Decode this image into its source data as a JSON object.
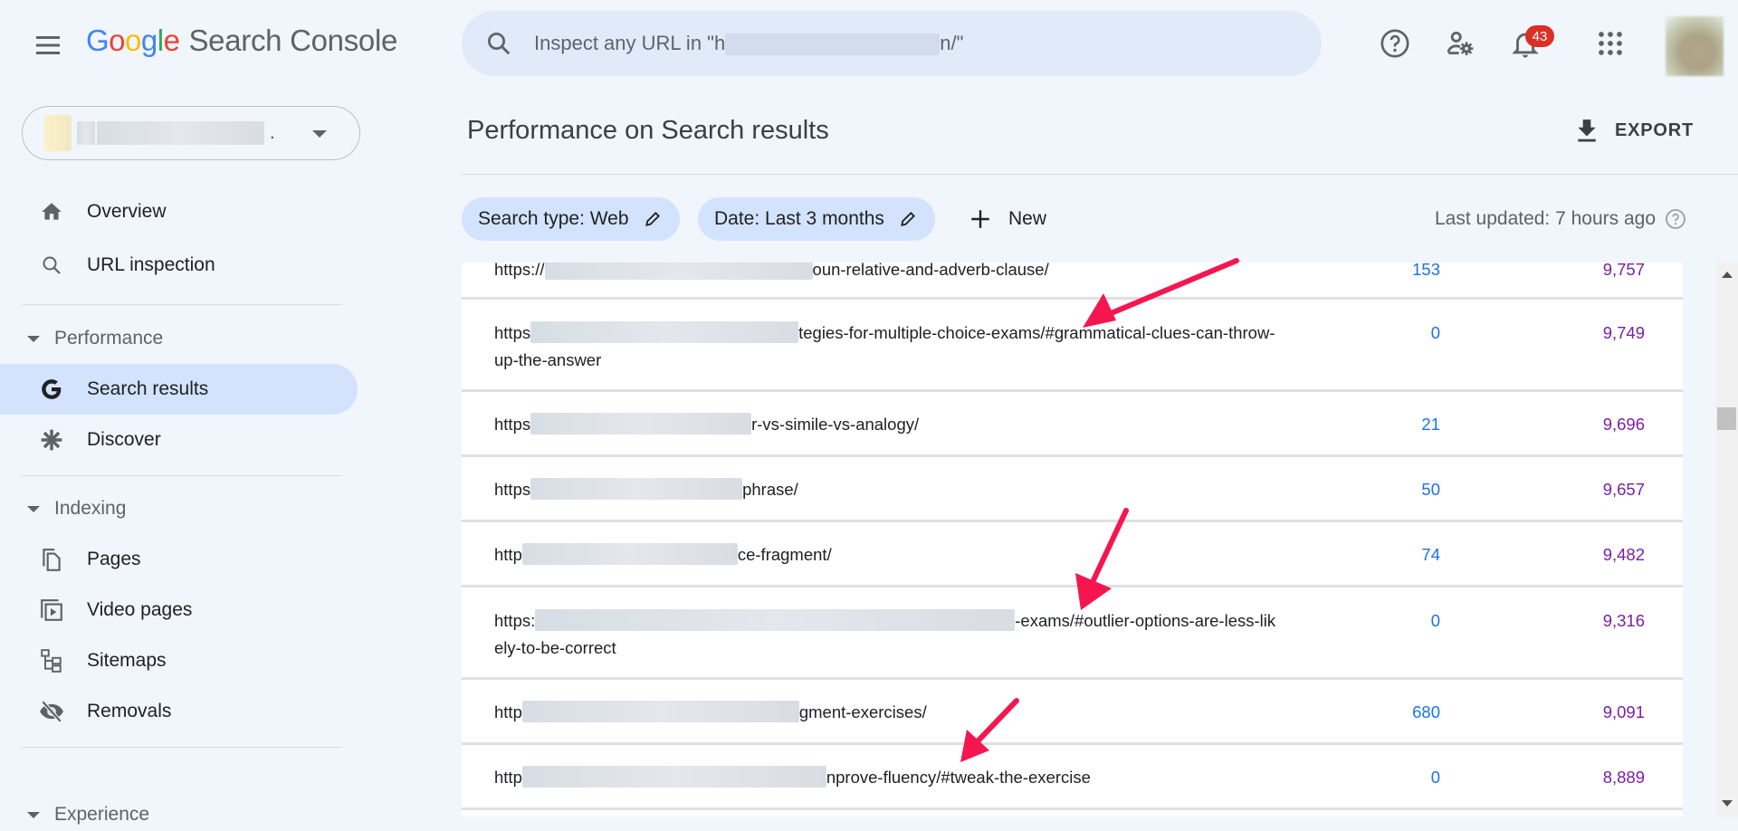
{
  "app": {
    "logo_google": [
      "G",
      "o",
      "o",
      "g",
      "l",
      "e"
    ],
    "logo_colors": [
      "#4285f4",
      "#ea4335",
      "#fbbc05",
      "#4285f4",
      "#34a853",
      "#ea4335"
    ],
    "product_name": "Search Console"
  },
  "search": {
    "placeholder_prefix": "Inspect any URL in \"h",
    "placeholder_suffix": "n/\""
  },
  "top_icons": {
    "help": "help-icon",
    "admin": "manage-accounts-icon",
    "notifications": "notifications-icon",
    "notification_count": "43",
    "apps": "apps-grid-icon"
  },
  "property": {
    "dot": "."
  },
  "sidebar": {
    "items": [
      {
        "label": "Overview",
        "icon": "home-icon"
      },
      {
        "label": "URL inspection",
        "icon": "search-icon"
      }
    ],
    "sections": [
      {
        "label": "Performance",
        "items": [
          {
            "label": "Search results",
            "icon": "google-g-icon",
            "active": true
          },
          {
            "label": "Discover",
            "icon": "asterisk-icon"
          }
        ]
      },
      {
        "label": "Indexing",
        "items": [
          {
            "label": "Pages",
            "icon": "pages-icon"
          },
          {
            "label": "Video pages",
            "icon": "video-pages-icon"
          },
          {
            "label": "Sitemaps",
            "icon": "sitemap-icon"
          },
          {
            "label": "Removals",
            "icon": "visibility-off-icon"
          }
        ]
      },
      {
        "label": "Experience"
      }
    ]
  },
  "main": {
    "title": "Performance on Search results",
    "export_label": "EXPORT",
    "filters": [
      {
        "label": "Search type: Web"
      },
      {
        "label": "Date: Last 3 months"
      }
    ],
    "new_label": "New",
    "last_updated": "Last updated: 7 hours ago"
  },
  "table": {
    "rows": [
      {
        "url_prefix": "https://",
        "url_suffix": "oun-relative-and-adverb-clause/",
        "clicks": "153",
        "impressions": "9,757"
      },
      {
        "url_prefix": "https",
        "url_suffix": "tegies-for-multiple-choice-exams/#grammatical-clues-can-throw-up-the-answer",
        "clicks": "0",
        "impressions": "9,749"
      },
      {
        "url_prefix": "https",
        "url_suffix": "r-vs-simile-vs-analogy/",
        "clicks": "21",
        "impressions": "9,696"
      },
      {
        "url_prefix": "https",
        "url_suffix": "phrase/",
        "clicks": "50",
        "impressions": "9,657"
      },
      {
        "url_prefix": "http",
        "url_suffix": "ce-fragment/",
        "clicks": "74",
        "impressions": "9,482"
      },
      {
        "url_prefix": "https:",
        "url_suffix": "-exams/#outlier-options-are-less-likely-to-be-correct",
        "clicks": "0",
        "impressions": "9,316"
      },
      {
        "url_prefix": "http",
        "url_suffix": "gment-exercises/",
        "clicks": "680",
        "impressions": "9,091"
      },
      {
        "url_prefix": "http",
        "url_suffix": "nprove-fluency/#tweak-the-exercise",
        "clicks": "0",
        "impressions": "8,889"
      }
    ]
  },
  "annotations": {
    "arrow_color": "#f5164f"
  }
}
